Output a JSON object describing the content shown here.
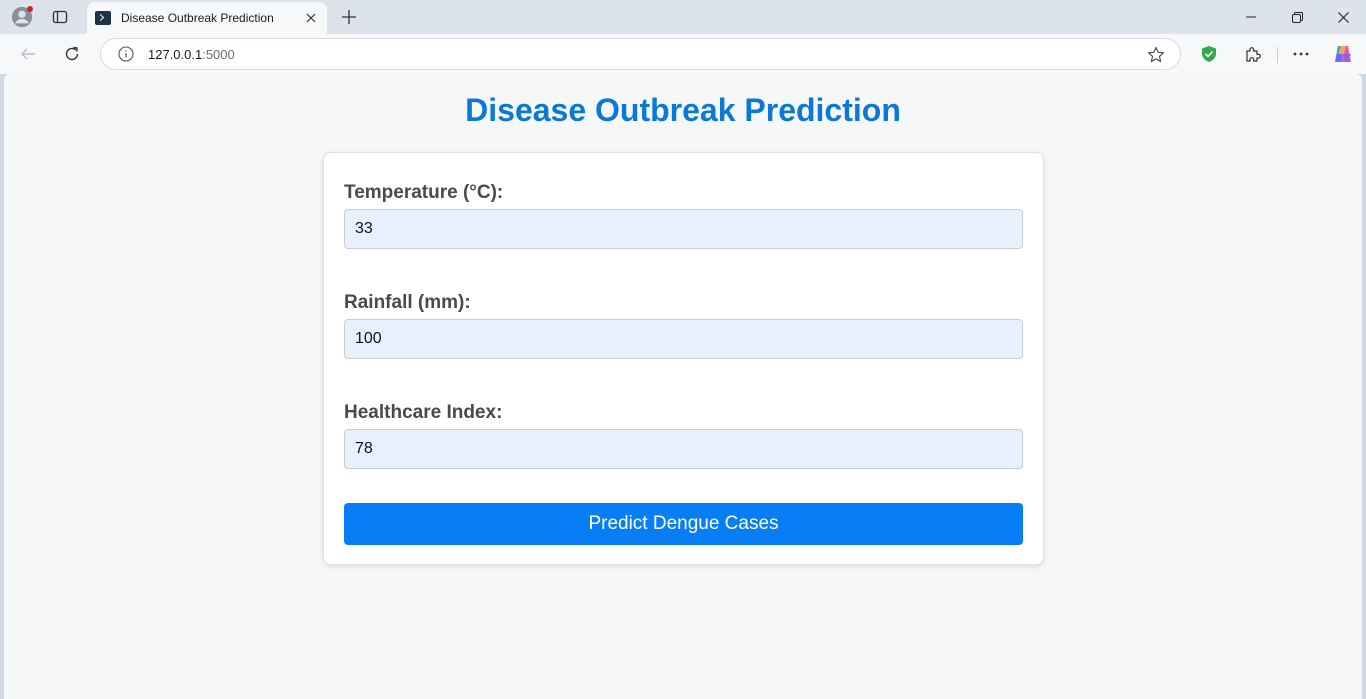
{
  "browser": {
    "tab_title": "Disease Outbreak Prediction",
    "url_host": "127.0.0.1",
    "url_port": ":5000"
  },
  "page": {
    "heading": "Disease Outbreak Prediction",
    "fields": [
      {
        "label": "Temperature (°C):",
        "value": "33"
      },
      {
        "label": "Rainfall (mm):",
        "value": "100"
      },
      {
        "label": "Healthcare Index:",
        "value": "78"
      }
    ],
    "submit_label": "Predict Dengue Cases"
  },
  "colors": {
    "accent": "#087ef6",
    "heading": "#0b78d8",
    "input_bg": "#e8f0fe"
  }
}
